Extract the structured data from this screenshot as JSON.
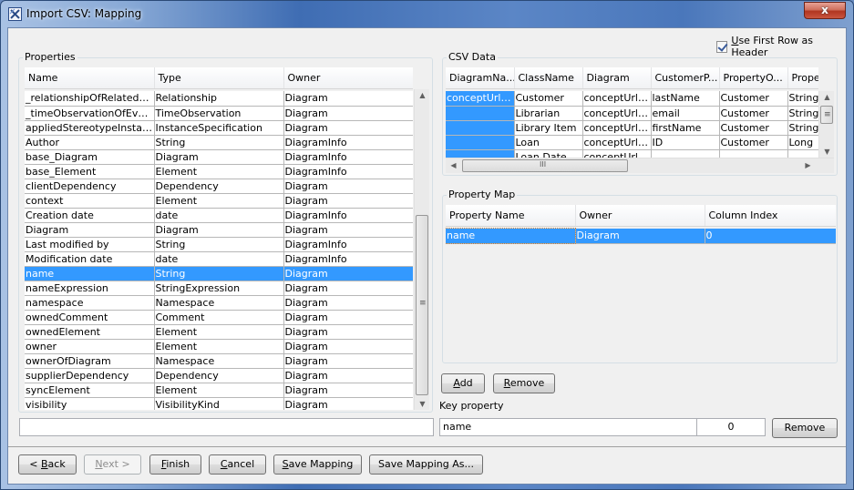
{
  "window": {
    "title": "Import CSV: Mapping",
    "close_glyph": "x"
  },
  "header": {
    "use_first_row_checkbox": {
      "label_prefix": "",
      "mnemonic": "U",
      "label_rest": "se First Row as Header",
      "checked": true
    }
  },
  "properties": {
    "group_label": "Properties",
    "columns": [
      "Name",
      "Type",
      "Owner"
    ],
    "rows": [
      [
        "_relationshipOfRelatedEle...",
        "Relationship",
        "Diagram"
      ],
      [
        "_timeObservationOfEvent",
        "TimeObservation",
        "Diagram"
      ],
      [
        "appliedStereotypeInstance",
        "InstanceSpecification",
        "Diagram"
      ],
      [
        "Author",
        "String",
        "DiagramInfo"
      ],
      [
        "base_Diagram",
        "Diagram",
        "DiagramInfo"
      ],
      [
        "base_Element",
        "Element",
        "DiagramInfo"
      ],
      [
        "clientDependency",
        "Dependency",
        "Diagram"
      ],
      [
        "context",
        "Element",
        "Diagram"
      ],
      [
        "Creation date",
        "date",
        "DiagramInfo"
      ],
      [
        "Diagram",
        "Diagram",
        "Diagram"
      ],
      [
        "Last modified by",
        "String",
        "DiagramInfo"
      ],
      [
        "Modification date",
        "date",
        "DiagramInfo"
      ],
      [
        "name",
        "String",
        "Diagram"
      ],
      [
        "nameExpression",
        "StringExpression",
        "Diagram"
      ],
      [
        "namespace",
        "Namespace",
        "Diagram"
      ],
      [
        "ownedComment",
        "Comment",
        "Diagram"
      ],
      [
        "ownedElement",
        "Element",
        "Diagram"
      ],
      [
        "owner",
        "Element",
        "Diagram"
      ],
      [
        "ownerOfDiagram",
        "Namespace",
        "Diagram"
      ],
      [
        "supplierDependency",
        "Dependency",
        "Diagram"
      ],
      [
        "syncElement",
        "Element",
        "Diagram"
      ],
      [
        "visibility",
        "VisibilityKind",
        "Diagram"
      ]
    ],
    "selected_row": 12,
    "filter_value": ""
  },
  "csv_data": {
    "group_label": "CSV Data",
    "columns": [
      "DiagramNa...",
      "ClassName",
      "Diagram",
      "CustomerP...",
      "PropertyO...",
      "Proper"
    ],
    "rows": [
      [
        "conceptUrlP...",
        "Customer",
        "conceptUrlP...",
        "lastName",
        "Customer",
        "String"
      ],
      [
        "",
        "Librarian",
        "conceptUrlP...",
        "email",
        "Customer",
        "String"
      ],
      [
        "",
        "Library Item",
        "conceptUrlP...",
        "firstName",
        "Customer",
        "String"
      ],
      [
        "",
        "Loan",
        "conceptUrlP...",
        "ID",
        "Customer",
        "Long"
      ],
      [
        "",
        "Loan Date",
        "conceptUrlP...",
        "",
        "",
        ""
      ]
    ],
    "selected_column": 0,
    "hscroll_grip": "III"
  },
  "property_map": {
    "group_label": "Property Map",
    "columns": [
      "Property Name",
      "Owner",
      "Column Index"
    ],
    "rows": [
      [
        "name",
        "Diagram",
        "0"
      ]
    ],
    "selected_row": 0,
    "add_button": {
      "mnemonic": "A",
      "rest": "dd"
    },
    "remove_button": {
      "mnemonic": "R",
      "rest": "emove"
    }
  },
  "key_property": {
    "label": "Key property",
    "name_value": "name",
    "index_value": "0",
    "remove_label": "Remove"
  },
  "footer": {
    "back": {
      "prefix": "< ",
      "mnemonic": "B",
      "rest": "ack"
    },
    "next": {
      "prefix": "",
      "mnemonic": "N",
      "rest": "ext >",
      "disabled": true
    },
    "finish": {
      "prefix": "",
      "mnemonic": "F",
      "rest": "inish"
    },
    "cancel": {
      "prefix": "",
      "mnemonic": "C",
      "rest": "ancel"
    },
    "save_mapping": {
      "prefix": "",
      "mnemonic": "S",
      "rest": "ave Mapping"
    },
    "save_mapping_as": "Save Mapping As..."
  },
  "colors": {
    "selection": "#3399ff",
    "dialog_bg": "#f0f0f0",
    "title_gradient_mid": "#3f6db3",
    "close_button": "#c9553f"
  }
}
